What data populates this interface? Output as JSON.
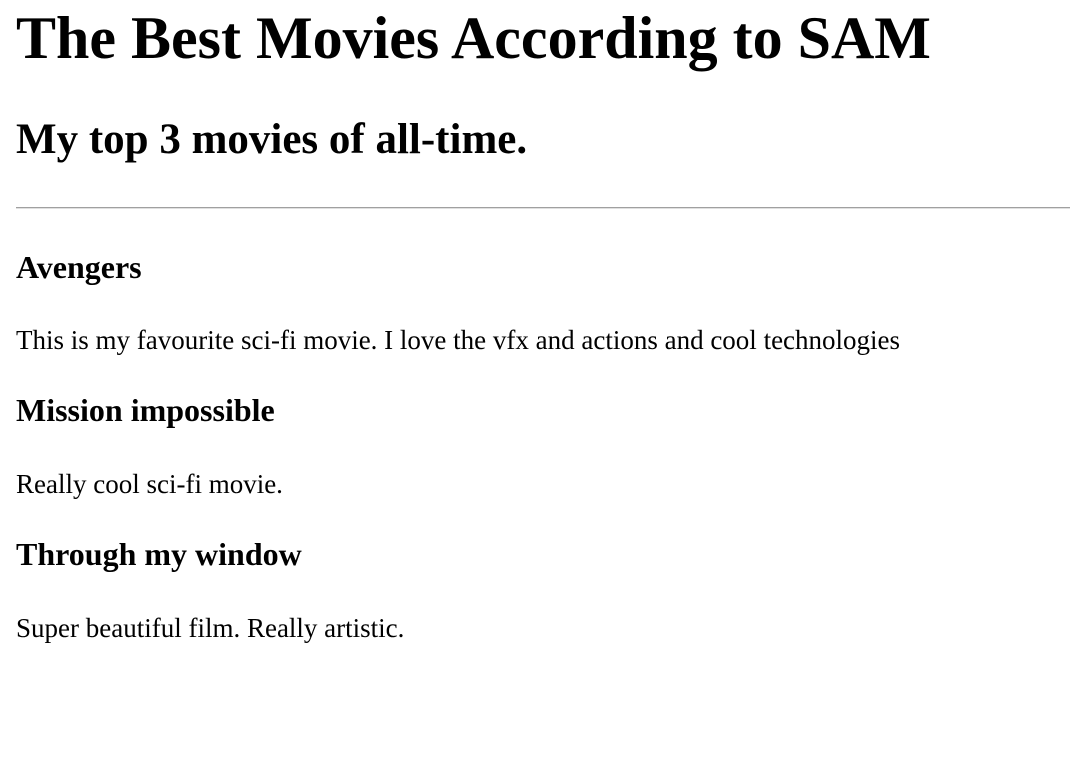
{
  "page": {
    "title": "The Best Movies According to SAM",
    "subtitle": "My top 3 movies of all-time."
  },
  "movies": [
    {
      "title": "Avengers",
      "description": "This is my favourite sci-fi movie. I love the vfx and actions and cool technologies"
    },
    {
      "title": "Mission impossible",
      "description": "Really cool sci-fi movie."
    },
    {
      "title": "Through my window",
      "description": "Super beautiful film. Really artistic."
    }
  ]
}
